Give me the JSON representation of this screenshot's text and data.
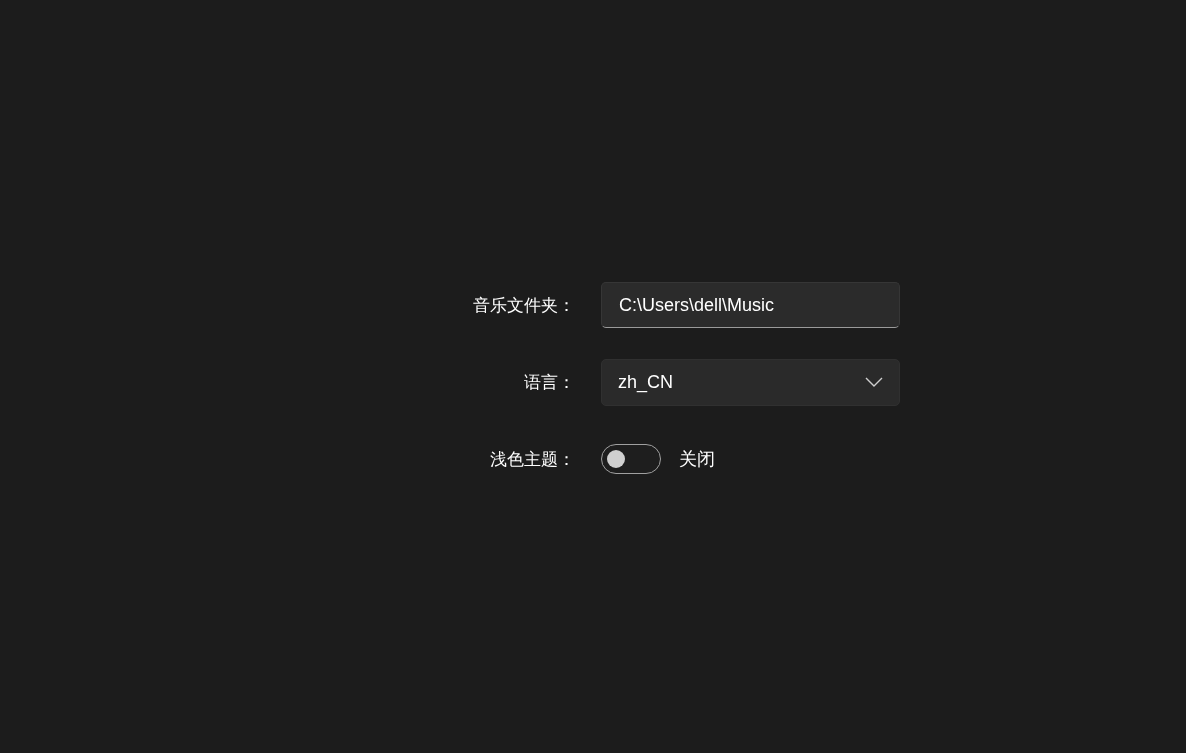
{
  "settings": [
    {
      "kind": "text",
      "label": "音乐文件夹：",
      "value": "C:\\Users\\dell\\Music"
    },
    {
      "kind": "dropdown",
      "label": "语言：",
      "value": "zh_CN"
    },
    {
      "kind": "toggle",
      "label": "浅色主题：",
      "on": false,
      "state_text": "关闭"
    }
  ]
}
